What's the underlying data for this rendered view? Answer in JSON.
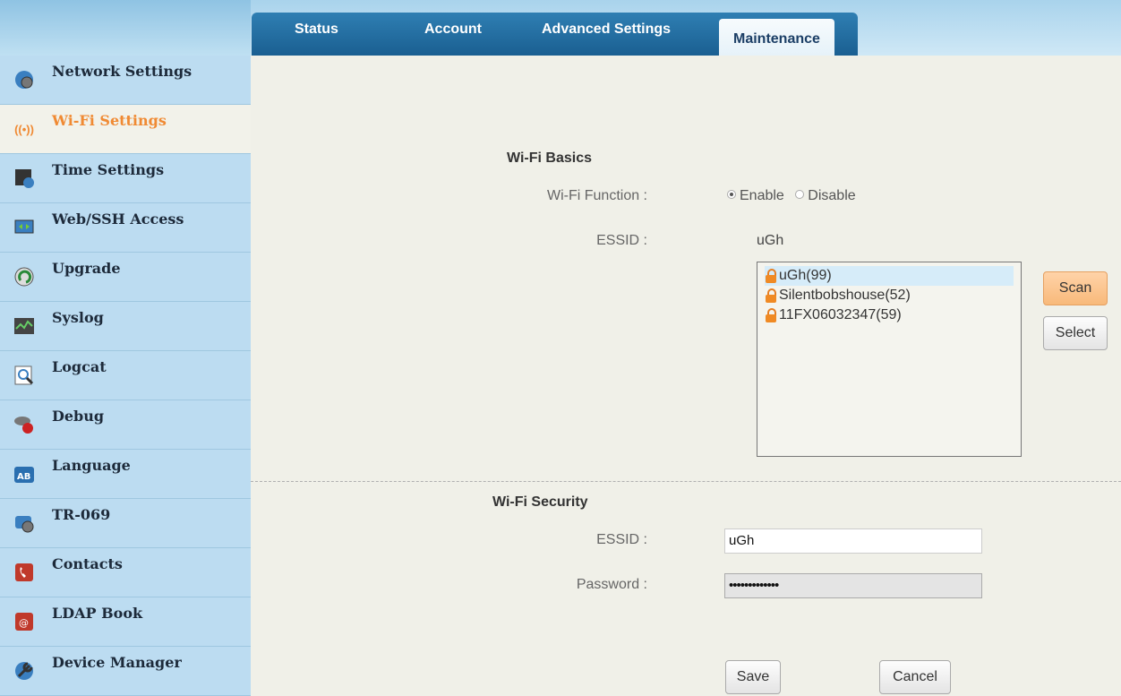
{
  "tabs": [
    {
      "label": "Status"
    },
    {
      "label": "Account"
    },
    {
      "label": "Advanced Settings"
    },
    {
      "label": "Maintenance"
    }
  ],
  "sidebar": {
    "items": [
      {
        "label": "Network Settings",
        "icon": "network-settings-icon"
      },
      {
        "label": "Wi-Fi Settings",
        "icon": "wifi-icon"
      },
      {
        "label": "Time Settings",
        "icon": "time-settings-icon"
      },
      {
        "label": "Web/SSH Access",
        "icon": "web-ssh-icon"
      },
      {
        "label": "Upgrade",
        "icon": "upgrade-icon"
      },
      {
        "label": "Syslog",
        "icon": "syslog-icon"
      },
      {
        "label": "Logcat",
        "icon": "logcat-icon"
      },
      {
        "label": "Debug",
        "icon": "debug-icon"
      },
      {
        "label": "Language",
        "icon": "language-icon"
      },
      {
        "label": "TR-069",
        "icon": "tr069-icon"
      },
      {
        "label": "Contacts",
        "icon": "contacts-icon"
      },
      {
        "label": "LDAP Book",
        "icon": "ldap-book-icon"
      },
      {
        "label": "Device Manager",
        "icon": "device-manager-icon"
      }
    ]
  },
  "wifi_basics": {
    "title": "Wi-Fi Basics",
    "function_label": "Wi-Fi Function :",
    "enable_label": "Enable",
    "disable_label": "Disable",
    "essid_label": "ESSID :",
    "essid_value": "uGh",
    "networks": [
      {
        "name": "uGh(99)"
      },
      {
        "name": "Silentbobshouse(52)"
      },
      {
        "name": "11FX06032347(59)"
      }
    ],
    "scan_label": "Scan",
    "select_label": "Select"
  },
  "wifi_security": {
    "title": "Wi-Fi Security",
    "essid_label": "ESSID :",
    "essid_value": "uGh",
    "password_label": "Password :",
    "password_mask": "•••••••••••••"
  },
  "actions": {
    "save_label": "Save",
    "cancel_label": "Cancel"
  },
  "colors": {
    "active_tab_text": "#1c3f66",
    "active_sidebar_text": "#f08a33",
    "tab_bar": "#1a5f91",
    "sidebar_bg": "#bcdcf1"
  }
}
